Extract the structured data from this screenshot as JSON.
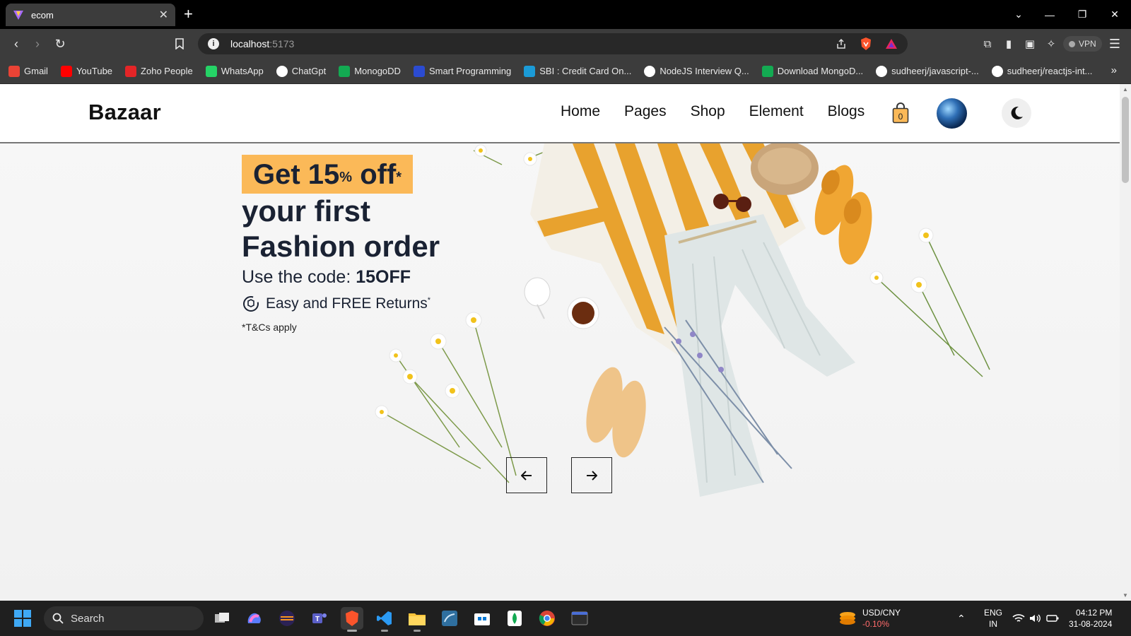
{
  "browser": {
    "tab_title": "ecom",
    "url_host": "localhost",
    "url_port": ":5173",
    "vpn_label": "VPN",
    "bookmarks": [
      {
        "label": "Gmail",
        "icon": "gmail-icon",
        "color": "#ea4335"
      },
      {
        "label": "YouTube",
        "icon": "youtube-icon",
        "color": "#ff0000"
      },
      {
        "label": "Zoho People",
        "icon": "zoho-icon",
        "color": "#e42527"
      },
      {
        "label": "WhatsApp",
        "icon": "whatsapp-icon",
        "color": "#25d366"
      },
      {
        "label": "ChatGpt",
        "icon": "chatgpt-icon",
        "color": "#ffffff"
      },
      {
        "label": "MonogoDD",
        "icon": "mongodb-icon",
        "color": "#13aa52"
      },
      {
        "label": "Smart Programming",
        "icon": "smart-programming-icon",
        "color": "#2b4bd1"
      },
      {
        "label": "SBI : Credit Card On...",
        "icon": "sbi-icon",
        "color": "#1b9bd7"
      },
      {
        "label": "NodeJS Interview Q...",
        "icon": "github-icon",
        "color": "#ffffff"
      },
      {
        "label": "Download MongoD...",
        "icon": "mongodb-icon",
        "color": "#13aa52"
      },
      {
        "label": "sudheerj/javascript-...",
        "icon": "github-icon",
        "color": "#ffffff"
      },
      {
        "label": "sudheerj/reactjs-int...",
        "icon": "github-icon",
        "color": "#ffffff"
      }
    ]
  },
  "site": {
    "logo": "Bazaar",
    "nav": [
      "Home",
      "Pages",
      "Shop",
      "Element",
      "Blogs"
    ],
    "cart_count": "0",
    "hero": {
      "badge_main": "Get 15",
      "badge_pct": "%",
      "badge_off": " off",
      "badge_star": "*",
      "line1": "your first",
      "line2": "Fashion order",
      "code_prefix": "Use the code: ",
      "code": "15OFF",
      "returns": "Easy and FREE Returns",
      "returns_star": "*",
      "tnc": "*T&Cs apply"
    },
    "accent": "#fbb958"
  },
  "taskbar": {
    "search_label": "Search",
    "ticker_pair": "USD/CNY",
    "ticker_change": "-0.10%",
    "lang_top": "ENG",
    "lang_bottom": "IN",
    "time": "04:12 PM",
    "date": "31-08-2024"
  }
}
